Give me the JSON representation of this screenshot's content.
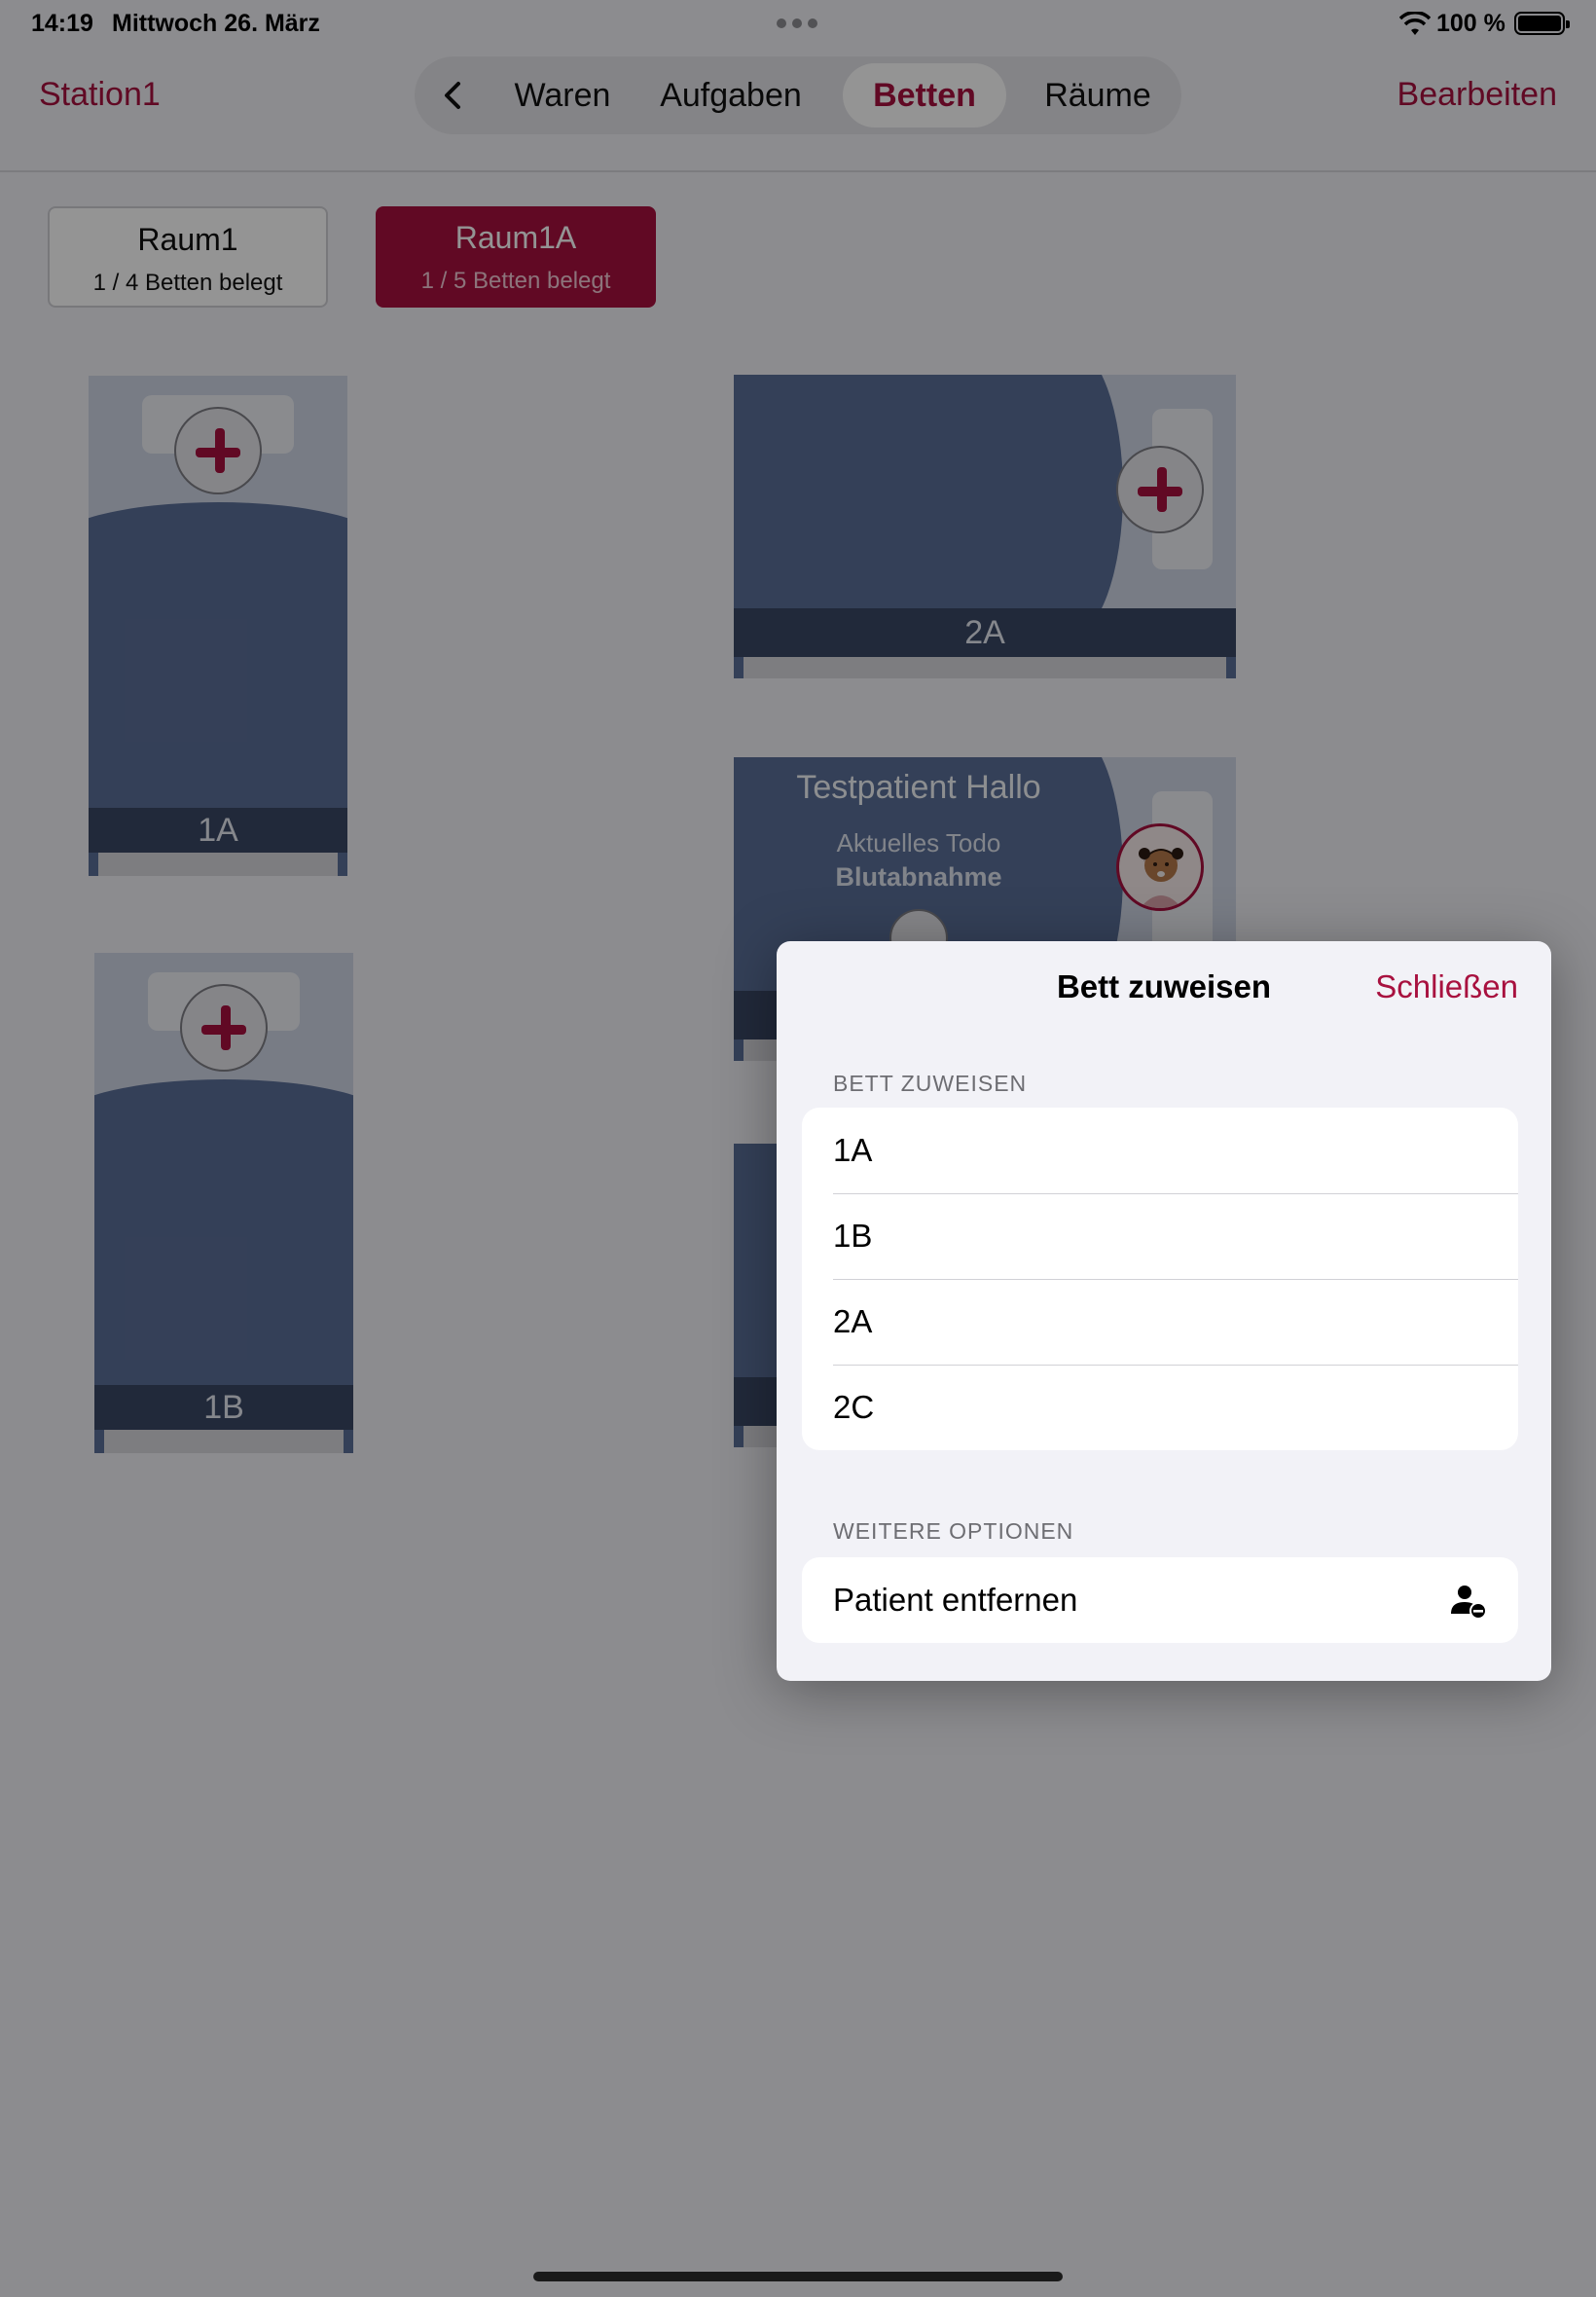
{
  "status_bar": {
    "time": "14:19",
    "date": "Mittwoch 26. März",
    "battery": "100 %"
  },
  "nav": {
    "station": "Station1",
    "edit": "Bearbeiten",
    "tabs": [
      {
        "label": "Waren",
        "active": false
      },
      {
        "label": "Aufgaben",
        "active": false
      },
      {
        "label": "Betten",
        "active": true
      },
      {
        "label": "Räume",
        "active": false
      }
    ]
  },
  "rooms": [
    {
      "name": "Raum1",
      "status": "1 / 4 Betten belegt",
      "selected": false
    },
    {
      "name": "Raum1A",
      "status": "1 / 5 Betten belegt",
      "selected": true
    }
  ],
  "beds": [
    {
      "label": "1A"
    },
    {
      "label": "1B"
    },
    {
      "label": "2A"
    },
    {
      "patient": "Testpatient Hallo",
      "todo_label": "Aktuelles Todo",
      "todo": "Blutabnahme"
    }
  ],
  "popover": {
    "title": "Bett zuweisen",
    "close": "Schließen",
    "section1": "BETT ZUWEISEN",
    "bed_options": [
      "1A",
      "1B",
      "2A",
      "2C"
    ],
    "section2": "WEITERE OPTIONEN",
    "remove_patient": "Patient entfernen",
    "remove_icon": "person-remove-icon"
  },
  "colors": {
    "accent": "#a8113f",
    "bed_blue": "#5b6f98",
    "bed_label": "#3a4865"
  }
}
